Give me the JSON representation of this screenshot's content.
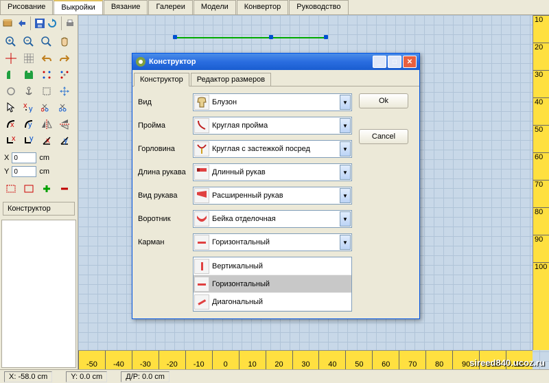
{
  "main_tabs": [
    "Рисование",
    "Выкройки",
    "Вязание",
    "Галереи",
    "Модели",
    "Конвертор",
    "Руководство"
  ],
  "main_tabs_active": 1,
  "coords": {
    "x_label": "X",
    "x_value": "0",
    "y_label": "Y",
    "y_value": "0",
    "unit": "cm"
  },
  "constructor_btn": "Конструктор",
  "ruler_h": [
    "-50",
    "-40",
    "-30",
    "-20",
    "-10",
    "0",
    "10",
    "20",
    "30",
    "40",
    "50",
    "60",
    "70",
    "80",
    "90",
    "100",
    "110"
  ],
  "ruler_v": [
    "10",
    "20",
    "30",
    "40",
    "50",
    "60",
    "70",
    "80",
    "90",
    "100"
  ],
  "dialog": {
    "title": "Конструктор",
    "tabs": [
      "Конструктор",
      "Редактор размеров"
    ],
    "tabs_active": 0,
    "fields": {
      "vid": {
        "label": "Вид",
        "value": "Блузон"
      },
      "proima": {
        "label": "Пройма",
        "value": "Круглая пройма"
      },
      "gorlovina": {
        "label": "Горловина",
        "value": "Круглая с застежкой посред"
      },
      "dlina_rukava": {
        "label": "Длина рукава",
        "value": "Длинный рукав"
      },
      "vid_rukava": {
        "label": "Вид рукава",
        "value": "Расширенный рукав"
      },
      "vorotnik": {
        "label": "Воротник",
        "value": "Бейка отделочная"
      },
      "karman": {
        "label": "Карман",
        "value": "Горизонтальный"
      }
    },
    "dropdown_options": [
      "Вертикальный",
      "Горизонтальный",
      "Диагональный"
    ],
    "dropdown_selected": 1,
    "ok": "Ok",
    "cancel": "Cancel"
  },
  "status": {
    "x": "X: -58.0 cm",
    "y": "Y: 0.0 cm",
    "dp": "Д/Р: 0.0 cm"
  },
  "watermark": "sireed840.ucoz.ru"
}
